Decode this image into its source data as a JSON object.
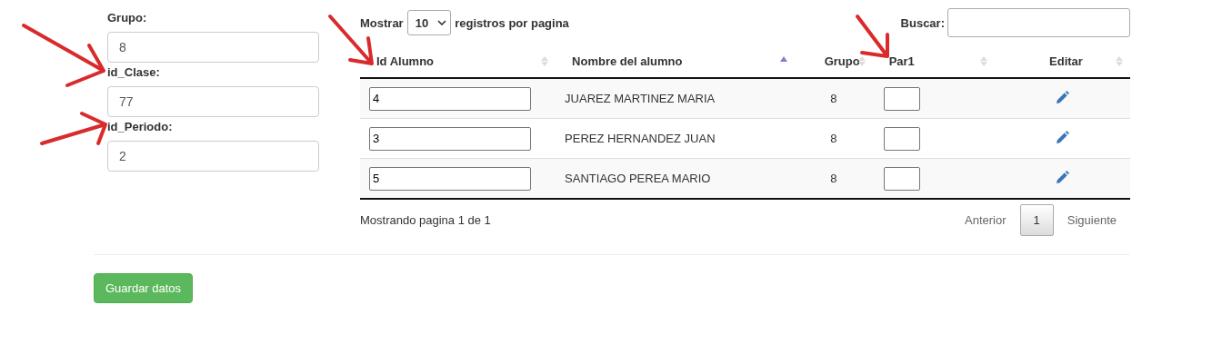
{
  "form": {
    "fields": [
      {
        "label": "Grupo:",
        "value": "8"
      },
      {
        "label": "id_Clase:",
        "value": "77"
      },
      {
        "label": "id_Periodo:",
        "value": "2"
      }
    ]
  },
  "table_controls": {
    "show_label": "Mostrar",
    "page_size": "10",
    "per_page_label": "registros por pagina",
    "search_label": "Buscar:"
  },
  "table": {
    "columns": [
      {
        "label": "Id Alumno",
        "sorted": false
      },
      {
        "label": "Nombre del alumno",
        "sorted": true
      },
      {
        "label": "Grupo",
        "sorted": false
      },
      {
        "label": "Par1",
        "sorted": false
      },
      {
        "label": "Editar",
        "sorted": false
      }
    ],
    "rows": [
      {
        "id": "4",
        "name": "JUAREZ MARTINEZ MARIA",
        "grupo": "8"
      },
      {
        "id": "3",
        "name": "PEREZ HERNANDEZ JUAN",
        "grupo": "8"
      },
      {
        "id": "5",
        "name": "SANTIAGO PEREA MARIO",
        "grupo": "8"
      }
    ]
  },
  "footer": {
    "info": "Mostrando pagina 1 de 1",
    "pagination": [
      {
        "label": "Anterior",
        "disabled": true,
        "selected": false
      },
      {
        "label": "1",
        "disabled": false,
        "selected": true
      },
      {
        "label": "Siguiente",
        "disabled": true,
        "selected": false
      }
    ]
  },
  "save_button": "Guardar datos"
}
